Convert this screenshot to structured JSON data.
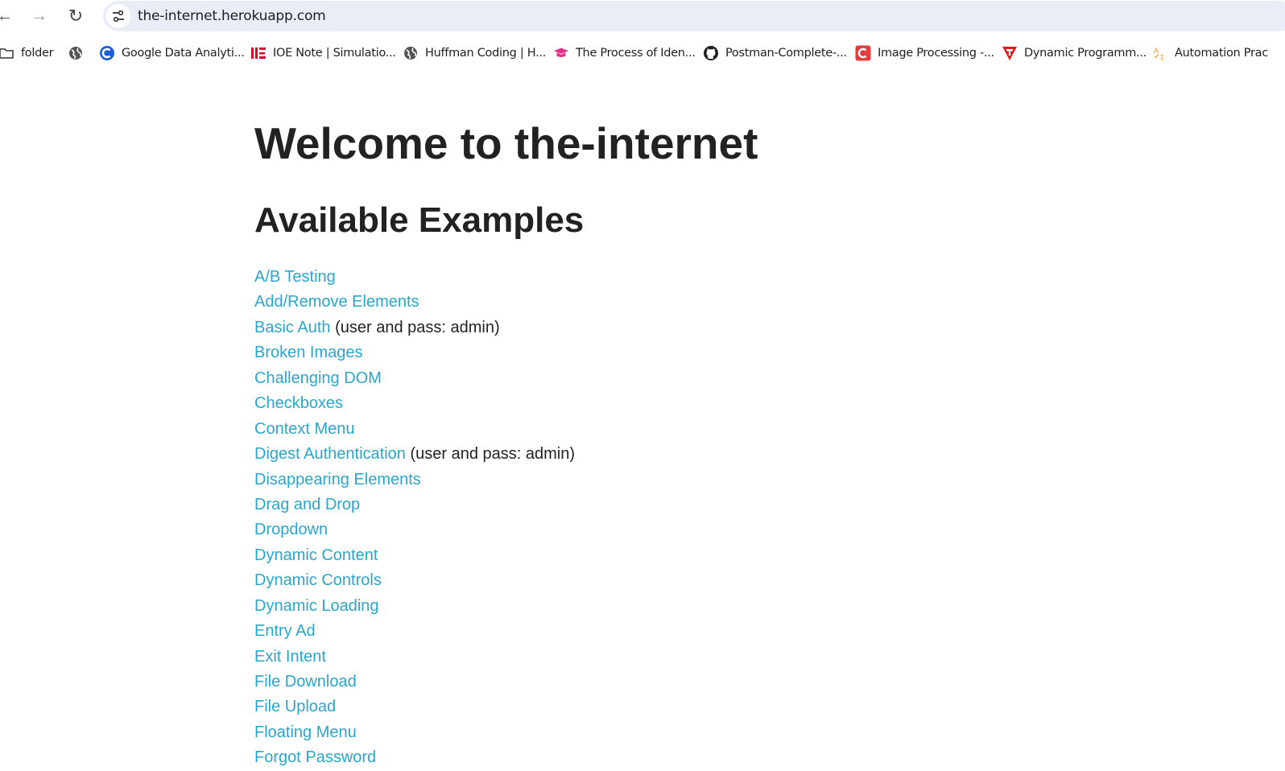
{
  "browser": {
    "url": "the-internet.herokuapp.com",
    "nav": {
      "back_glyph": "←",
      "forward_glyph": "→",
      "reload_glyph": "↻"
    }
  },
  "bookmarks": [
    {
      "label": "folder",
      "icon": "folder-icon"
    },
    {
      "label": "",
      "icon": "globe-icon"
    },
    {
      "label": "Google Data Analyti...",
      "icon": "c-logo-icon"
    },
    {
      "label": "IOE Note | Simulatio...",
      "icon": "ioe-logo-icon"
    },
    {
      "label": "Huffman Coding | H...",
      "icon": "globe-icon"
    },
    {
      "label": "The Process of Iden...",
      "icon": "graduation-cap-icon"
    },
    {
      "label": "Postman-Complete-...",
      "icon": "github-icon"
    },
    {
      "label": "Image Processing -...",
      "icon": "c-red-logo-icon"
    },
    {
      "label": "Dynamic Programm...",
      "icon": "t-logo-icon"
    },
    {
      "label": "Automation Prac",
      "icon": "translate-icon"
    }
  ],
  "page": {
    "title": "Welcome to the-internet",
    "subtitle": "Available Examples",
    "link_color": "#2ba6cb",
    "examples": [
      {
        "label": "A/B Testing",
        "note": ""
      },
      {
        "label": "Add/Remove Elements",
        "note": ""
      },
      {
        "label": "Basic Auth",
        "note": " (user and pass: admin)"
      },
      {
        "label": "Broken Images",
        "note": ""
      },
      {
        "label": "Challenging DOM",
        "note": ""
      },
      {
        "label": "Checkboxes",
        "note": ""
      },
      {
        "label": "Context Menu",
        "note": ""
      },
      {
        "label": "Digest Authentication",
        "note": " (user and pass: admin)"
      },
      {
        "label": "Disappearing Elements",
        "note": ""
      },
      {
        "label": "Drag and Drop",
        "note": ""
      },
      {
        "label": "Dropdown",
        "note": ""
      },
      {
        "label": "Dynamic Content",
        "note": ""
      },
      {
        "label": "Dynamic Controls",
        "note": ""
      },
      {
        "label": "Dynamic Loading",
        "note": ""
      },
      {
        "label": "Entry Ad",
        "note": ""
      },
      {
        "label": "Exit Intent",
        "note": ""
      },
      {
        "label": "File Download",
        "note": ""
      },
      {
        "label": "File Upload",
        "note": ""
      },
      {
        "label": "Floating Menu",
        "note": ""
      },
      {
        "label": "Forgot Password",
        "note": ""
      }
    ]
  }
}
